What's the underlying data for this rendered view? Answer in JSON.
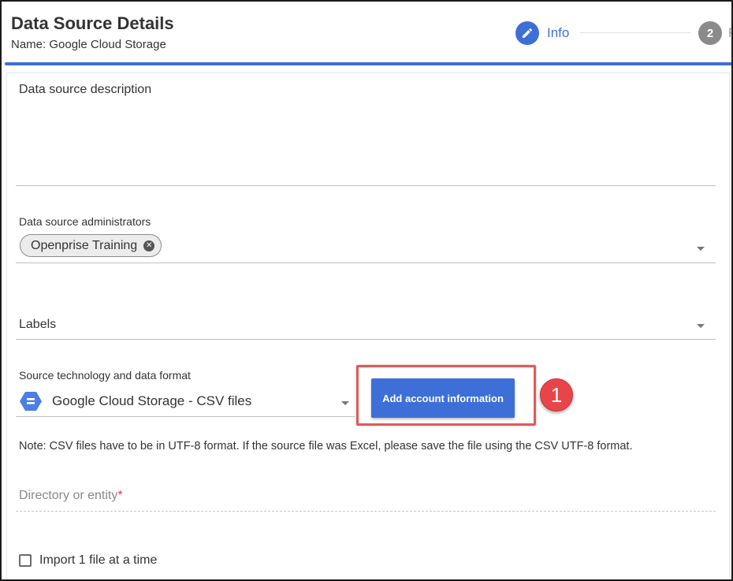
{
  "header": {
    "title": "Data Source Details",
    "subtitle": "Name: Google Cloud Storage",
    "steps": [
      {
        "number": "",
        "label": "Info",
        "state": "active",
        "icon": "pencil-icon"
      },
      {
        "number": "2",
        "label": "P",
        "state": "inactive"
      }
    ]
  },
  "form": {
    "description_label": "Data source description",
    "admins_label": "Data source administrators",
    "admins_chips": [
      "Openprise Training"
    ],
    "labels_label": "Labels",
    "source_label": "Source technology and data format",
    "source_value": "Google Cloud Storage - CSV files",
    "source_icon": "google-cloud-storage-icon",
    "add_account_button": "Add account information",
    "callout_number": "1",
    "note": "Note: CSV files have to be in UTF-8 format. If the source file was Excel, please save the file using the CSV UTF-8 format.",
    "directory_label": "Directory or entity",
    "directory_required": "*",
    "import_checkbox_label": "Import 1 file at a time",
    "import_checkbox_checked": false
  },
  "colors": {
    "accent": "#3e6fd8",
    "callout": "#e8454a",
    "highlight_border": "#e05a5a",
    "required": "#e53935"
  }
}
